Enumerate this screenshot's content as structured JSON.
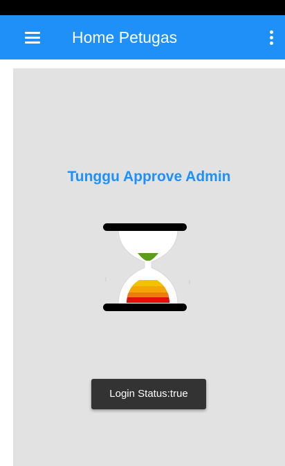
{
  "app_bar": {
    "title": "Home Petugas",
    "menu_icon": "hamburger-menu-icon",
    "overflow_icon": "more-vert-icon",
    "color": "#1e90f8"
  },
  "content": {
    "status_text": "Tunggu Approve Admin",
    "image_icon": "hourglass-icon",
    "background": "#e2e2e2"
  },
  "toast": {
    "text": "Login Status:true"
  }
}
